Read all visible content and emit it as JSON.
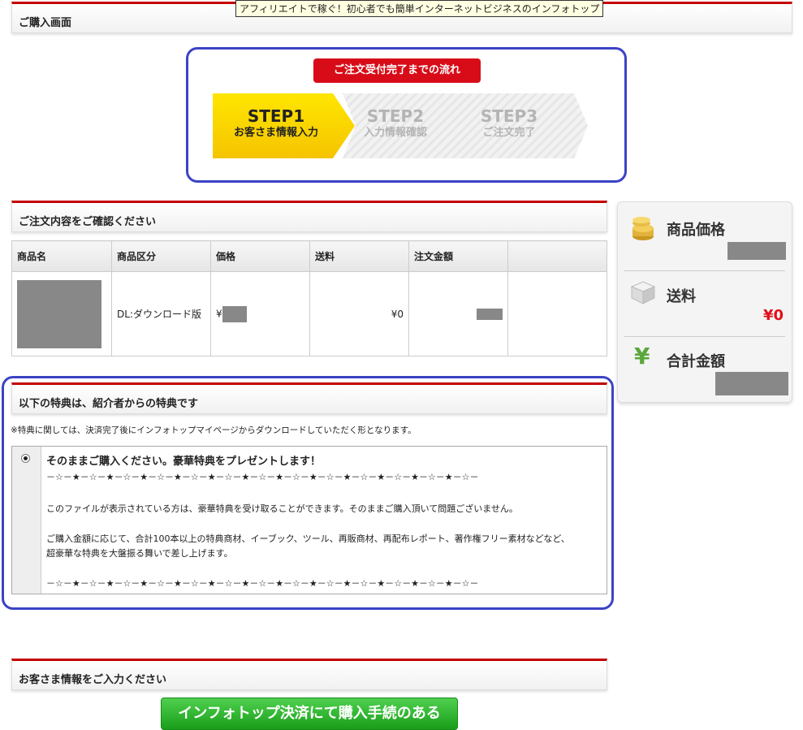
{
  "tooltip": "アフィリエイトで稼ぐ！初心者でも簡単インターネットビジネスのインフォトップ",
  "page_title": "ご購入画面",
  "flow": {
    "title": "ご注文受付完了までの流れ",
    "steps": [
      {
        "label": "STEP1",
        "desc": "お客さま情報入力"
      },
      {
        "label": "STEP2",
        "desc": "入力情報確認"
      },
      {
        "label": "STEP3",
        "desc": "ご注文完了"
      }
    ]
  },
  "order_section_title": "ご注文内容をご確認ください",
  "order_table": {
    "headers": [
      "商品名",
      "商品区分",
      "価格",
      "送料",
      "注文金額",
      ""
    ],
    "row": {
      "category": "DL:ダウンロード版",
      "price_prefix": "¥",
      "shipping": "¥0"
    }
  },
  "summary": {
    "product_price_label": "商品価格",
    "shipping_label": "送料",
    "shipping_value": "¥0",
    "total_label": "合計金額"
  },
  "benefit": {
    "section_title": "以下の特典は、紹介者からの特典です",
    "note": "※特典に関しては、決済完了後にインフォトップマイページからダウンロードしていただく形となります。",
    "title": "そのままご購入ください。豪華特典をプレゼントします！",
    "separator": "－☆－★－☆－★－☆－★－☆－★－☆－★－☆－★－☆－★－☆－★－☆－★－☆－★－☆－★－☆－★－☆－",
    "line1": "このファイルが表示されている方は、豪華特典を受け取ることができます。そのままご購入頂いて問題ございません。",
    "line2": "ご購入金額に応じて、合計100本以上の特典商材、イーブック、ツール、再販商材、再配布レポート、著作権フリー素材などなど、",
    "line3": "超豪華な特典を大盤振る舞いで差し上げます。"
  },
  "customer_section_title": "お客さま情報をご入力ください",
  "submit_button": "インフォトップ決済にて購入手続のある"
}
